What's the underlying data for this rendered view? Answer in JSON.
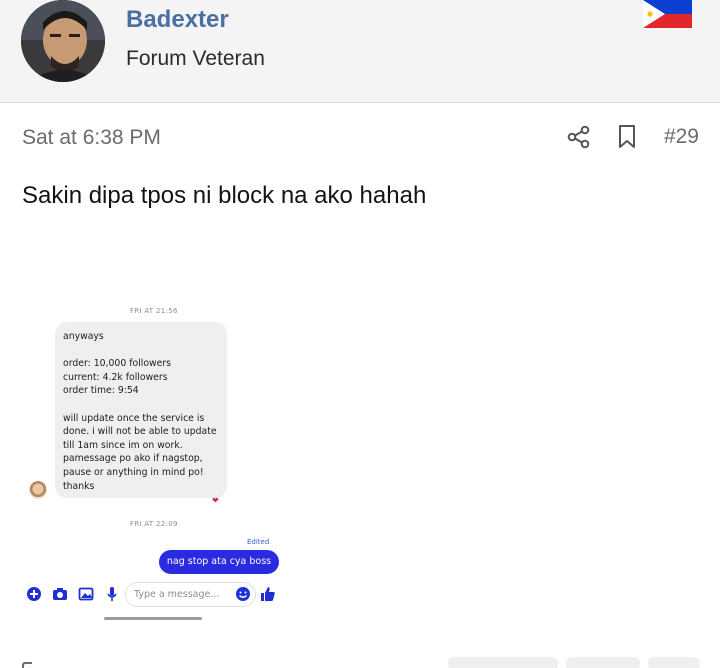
{
  "user": {
    "name": "Badexter",
    "title": "Forum Veteran",
    "flag_icon": "philippines-flag-icon"
  },
  "post": {
    "timestamp": "Sat at 6:38 PM",
    "number": "#29",
    "share_icon": "share-icon",
    "bookmark_icon": "bookmark-icon",
    "text": "Sakin dipa tpos ni block na ako hahah"
  },
  "screenshot": {
    "timestamp_1": "FRI AT 21:56",
    "incoming_message": "anyways\n\norder: 10,000 followers\ncurrent: 4.2k followers\norder time: 9:54\n\nwill update once the service is\ndone. i will not be able to update\ntill 1am since im on work.\npamessage po ako if nagstop,\npause or anything in mind po!\nthanks",
    "reaction": "❤",
    "timestamp_2": "FRI AT 22:09",
    "edited_label": "Edited",
    "outgoing_message": "nag stop ata cya boss",
    "composer_placeholder": "Type a message...",
    "colors": {
      "outgoing_bubble": "#2a2be0",
      "incoming_bubble": "#efeff1"
    }
  }
}
